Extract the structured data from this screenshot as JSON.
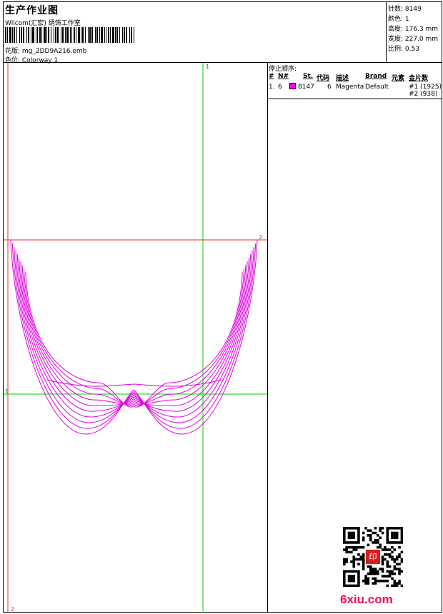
{
  "header": {
    "title": "生产作业图",
    "company": "Wilcom(汇宏) 绣饰工作室",
    "design_label": "花版: mg_2DD9A216.emb",
    "colorway_label": "色位: Colorway 1"
  },
  "stats": {
    "stitches": "针数: 8149",
    "colors": "颜色: 1",
    "height": "高度: 176.3 mm",
    "width": "宽度: 227.0 mm",
    "scale": "比例: 0.53"
  },
  "stop_sequence": {
    "title": "停止顺序:",
    "headers": {
      "num": "#",
      "needle": "N#",
      "st": "St.",
      "code": "代码",
      "desc": "描述",
      "brand": "Brand",
      "element": "元素",
      "sequin": "金片数"
    },
    "row": {
      "num": "1.",
      "needle": "6",
      "st": "8147",
      "code": "6",
      "desc": "Magenta",
      "brand": "Default",
      "sequin1": "#1 (1925)",
      "sequin2": "#2 (938)",
      "color": "#ff00ff"
    }
  },
  "guides": {
    "v_top": "1",
    "h_right": "2",
    "h_left": "1",
    "bottom_left": "2"
  },
  "watermark": {
    "brand": "6xiu.com",
    "stamp": "印"
  },
  "colors": {
    "thread": "#e000e0",
    "guide_green": "#00d000",
    "guide_red": "#ff2020"
  }
}
